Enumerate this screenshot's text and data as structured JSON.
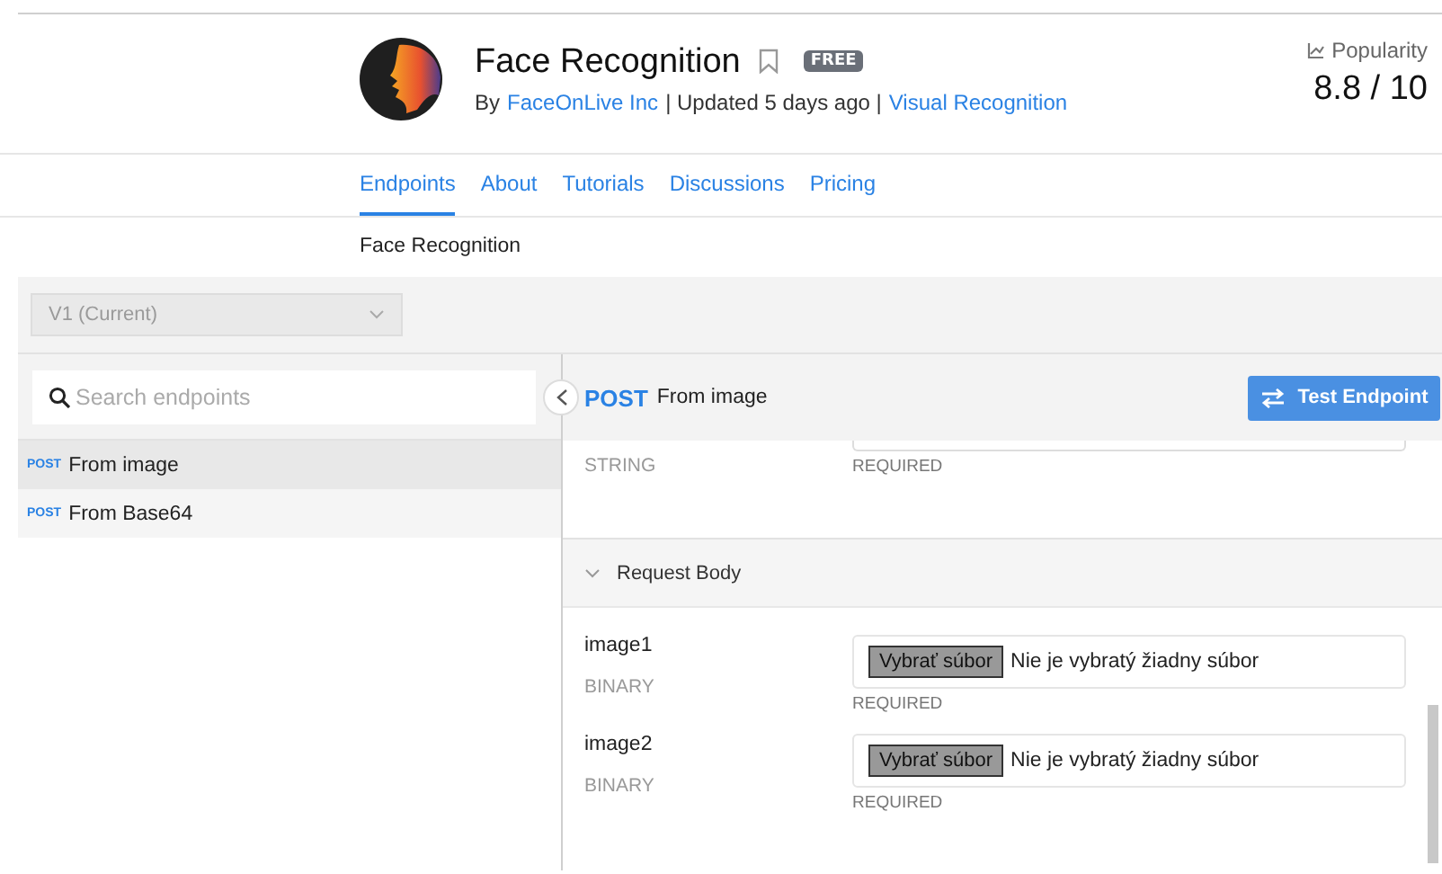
{
  "header": {
    "title": "Face Recognition",
    "badge": "FREE",
    "by": "By",
    "provider": "FaceOnLive Inc",
    "updated": "| Updated 5 days ago |",
    "category": "Visual Recognition",
    "popularity_label": "Popularity",
    "popularity_value": "8.8 / 10"
  },
  "tabs": [
    {
      "label": "Endpoints",
      "selected": true
    },
    {
      "label": "About",
      "selected": false
    },
    {
      "label": "Tutorials",
      "selected": false
    },
    {
      "label": "Discussions",
      "selected": false
    },
    {
      "label": "Pricing",
      "selected": false
    }
  ],
  "subtitle": "Face Recognition",
  "version_select": {
    "value": "V1 (Current)"
  },
  "search": {
    "placeholder": "Search endpoints"
  },
  "endpoints": [
    {
      "method": "POST",
      "name": "From image",
      "selected": true
    },
    {
      "method": "POST",
      "name": "From Base64",
      "selected": false
    }
  ],
  "endpoint_header": {
    "method": "POST",
    "name": "From image",
    "test_button": "Test Endpoint"
  },
  "params": [
    {
      "kind": "text",
      "type": "STRING",
      "required": "REQUIRED"
    }
  ],
  "request_body": {
    "title": "Request Body",
    "expanded": true,
    "fields": [
      {
        "kind": "file",
        "name": "image1",
        "type": "BINARY",
        "button": "Vybrať súbor",
        "status": "Nie je vybratý žiadny súbor",
        "required": "REQUIRED"
      },
      {
        "kind": "file",
        "name": "image2",
        "type": "BINARY",
        "button": "Vybrať súbor",
        "status": "Nie je vybratý žiadny súbor",
        "required": "REQUIRED"
      }
    ]
  }
}
